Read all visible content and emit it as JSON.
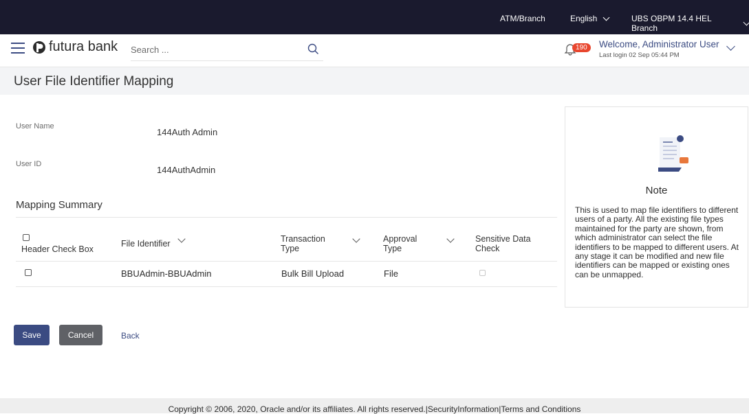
{
  "topbar": {
    "atm_branch": "ATM/Branch",
    "language": "English",
    "branch": "UBS OBPM 14.4 HEL Branch"
  },
  "header": {
    "brand": "futura bank",
    "search_placeholder": "Search ...",
    "notification_count": "190",
    "welcome": "Welcome, Administrator User",
    "last_login": "Last login 02 Sep 05:44 PM"
  },
  "page": {
    "title": "User File Identifier Mapping"
  },
  "user": {
    "name_label": "User Name",
    "name_value": "144Auth Admin",
    "id_label": "User ID",
    "id_value": "144AuthAdmin"
  },
  "summary": {
    "title": "Mapping Summary",
    "columns": {
      "header_check": "Header Check Box",
      "file_identifier": "File Identifier",
      "transaction_type": "Transaction Type",
      "approval_type": "Approval Type",
      "sensitive": "Sensitive Data Check"
    },
    "rows": [
      {
        "file_identifier": "BBUAdmin-BBUAdmin",
        "transaction_type": "Bulk Bill Upload",
        "approval_type": "File"
      }
    ]
  },
  "note": {
    "title": "Note",
    "text": "This is used to map file identifiers to different users of a party. All the existing file types maintained for the party are shown, from which administrator can select the file identifiers to be mapped to different users. At any stage it can be modified and new file identifiers can be mapped or existing ones can be unmapped."
  },
  "actions": {
    "save": "Save",
    "cancel": "Cancel",
    "back": "Back"
  },
  "footer": {
    "text": "Copyright © 2006, 2020, Oracle and/or its affiliates. All rights reserved.|SecurityInformation|Terms and Conditions"
  },
  "colors": {
    "topbar_bg": "#1a1a2e",
    "primary": "#3b4b82",
    "badge": "#e8462e"
  }
}
